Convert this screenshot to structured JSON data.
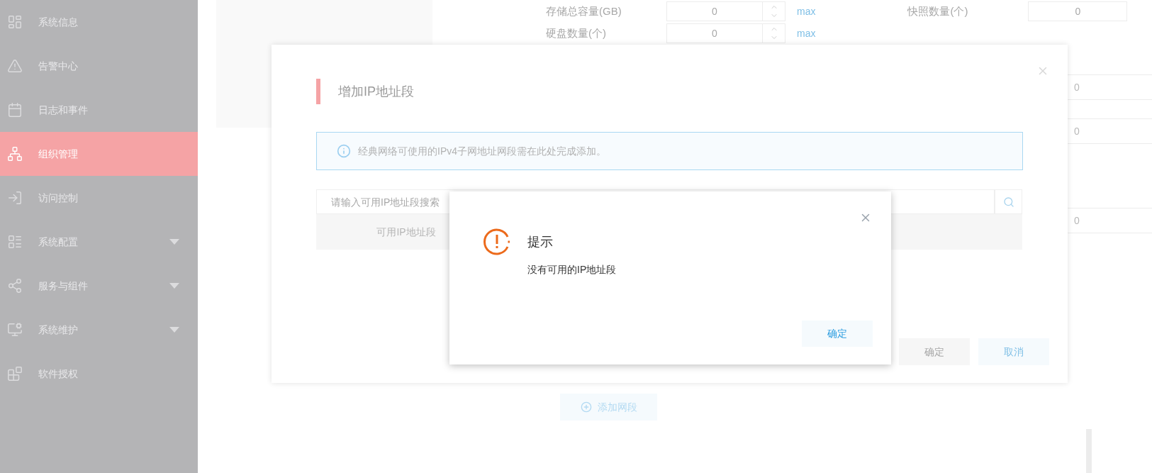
{
  "sidebar": {
    "items": [
      {
        "label": "系统信息",
        "selected": false
      },
      {
        "label": "告警中心",
        "selected": false
      },
      {
        "label": "日志和事件",
        "selected": false
      },
      {
        "label": "组织管理",
        "selected": true
      },
      {
        "label": "访问控制",
        "selected": false
      },
      {
        "label": "系统配置",
        "selected": false,
        "expanded": false
      },
      {
        "label": "服务与组件",
        "selected": false,
        "expanded": false
      },
      {
        "label": "系统维护",
        "selected": false,
        "expanded": false
      },
      {
        "label": "软件授权",
        "selected": false
      }
    ]
  },
  "form_rows": [
    {
      "fields": [
        {
          "label": "存储总容量(GB)",
          "value": "0",
          "link": "max"
        },
        {
          "label": "快照数量(个)",
          "value": "0"
        }
      ]
    },
    {
      "fields": [
        {
          "label": "硬盘数量(个)",
          "value": "0",
          "link": "max"
        }
      ]
    }
  ],
  "side_table": {
    "rows": [
      {
        "value": "0"
      },
      {
        "value": "0"
      },
      {
        "value": "0"
      }
    ]
  },
  "add_button": "添加网段",
  "dialog": {
    "title": "增加IP地址段",
    "info": "经典网络可使用的IPv4子网地址网段需在此处完成添加。",
    "search": {
      "placeholder": "请输入可用IP地址段搜索"
    },
    "table": {
      "columns": [
        "可用IP地址段"
      ]
    },
    "buttons": [
      {
        "label": "确定",
        "disabled": true
      },
      {
        "label": "取消",
        "disabled": false
      }
    ]
  },
  "alert": {
    "title": "提示",
    "message": "没有可用的IP地址段",
    "button": "确定"
  }
}
